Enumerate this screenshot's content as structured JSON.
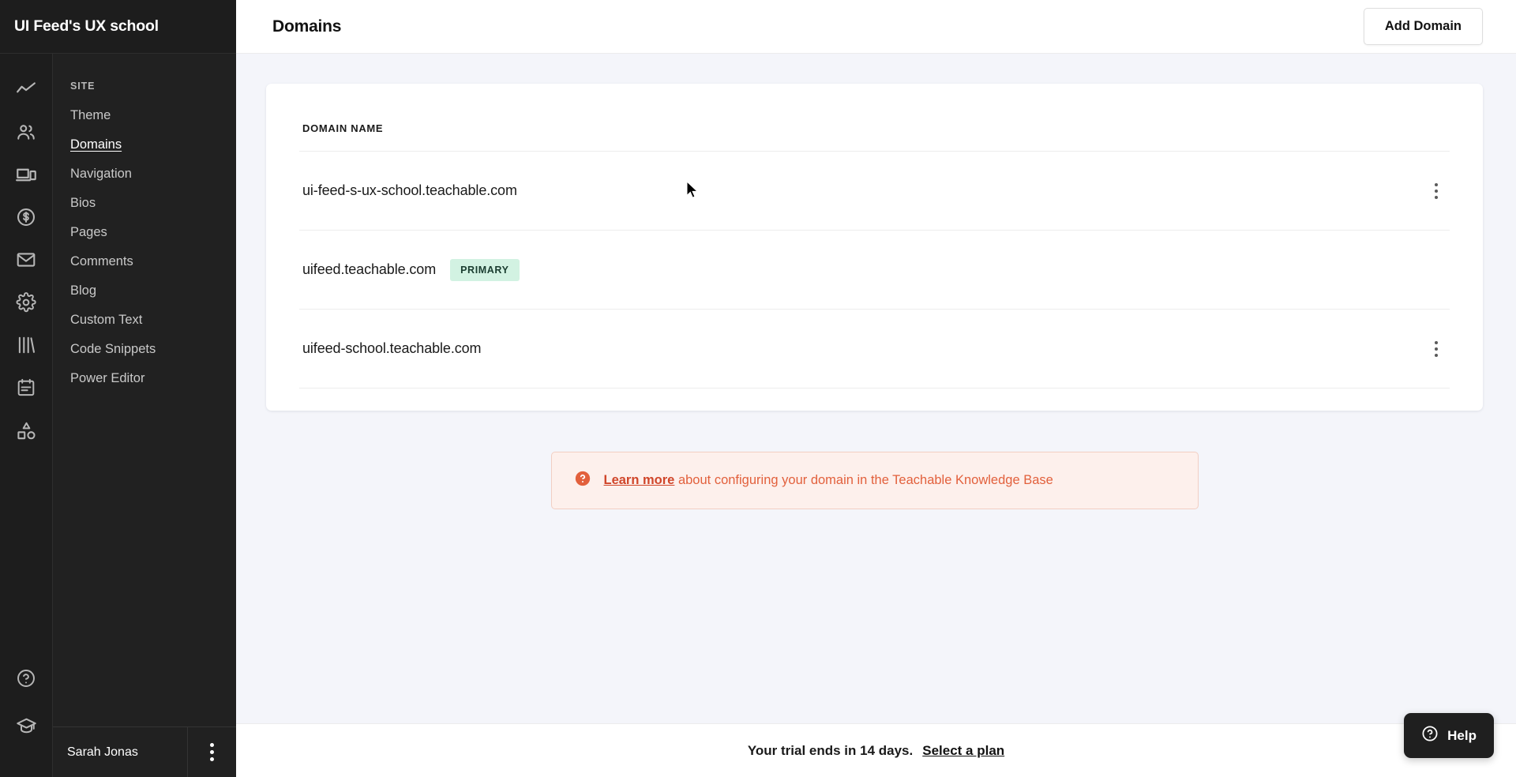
{
  "sidebar": {
    "school_title": "UI Feed's UX school",
    "section_label": "SITE",
    "items": [
      {
        "label": "Theme",
        "active": false
      },
      {
        "label": "Domains",
        "active": true
      },
      {
        "label": "Navigation",
        "active": false
      },
      {
        "label": "Bios",
        "active": false
      },
      {
        "label": "Pages",
        "active": false
      },
      {
        "label": "Comments",
        "active": false
      },
      {
        "label": "Blog",
        "active": false
      },
      {
        "label": "Custom Text",
        "active": false
      },
      {
        "label": "Code Snippets",
        "active": false
      },
      {
        "label": "Power Editor",
        "active": false
      }
    ],
    "user_name": "Sarah Jonas",
    "user_menu_icon": "kebab-vertical-icon"
  },
  "icon_rail": {
    "icons": [
      "analytics-line-chart-icon",
      "users-icon",
      "site-devices-icon",
      "dollar-circle-icon",
      "email-envelope-icon",
      "settings-gear-icon",
      "library-books-icon",
      "clipboard-notes-icon",
      "shapes-icon"
    ],
    "bottom_icons": [
      "help-circle-icon",
      "graduation-cap-icon"
    ]
  },
  "topbar": {
    "title": "Domains",
    "add_domain_label": "Add Domain"
  },
  "table": {
    "header": "DOMAIN NAME",
    "rows": [
      {
        "domain": "ui-feed-s-ux-school.teachable.com",
        "badge": "",
        "has_menu": true
      },
      {
        "domain": "uifeed.teachable.com",
        "badge": "PRIMARY",
        "has_menu": false
      },
      {
        "domain": "uifeed-school.teachable.com",
        "badge": "",
        "has_menu": true
      }
    ]
  },
  "alert": {
    "icon": "question-circle-icon",
    "link_text": "Learn more",
    "rest_text": " about configuring your domain in the Teachable Knowledge Base"
  },
  "trial": {
    "message": "Your trial ends in 14 days.",
    "link": "Select a plan"
  },
  "help": {
    "label": "Help",
    "icon": "question-circle-icon"
  },
  "colors": {
    "sidebar_bg": "#212121",
    "rail_bg": "#1d1d1d",
    "page_bg": "#f4f5fa",
    "badge_bg": "#d2f2e2",
    "alert_bg": "#fdf0ec",
    "alert_accent": "#e2603c"
  }
}
